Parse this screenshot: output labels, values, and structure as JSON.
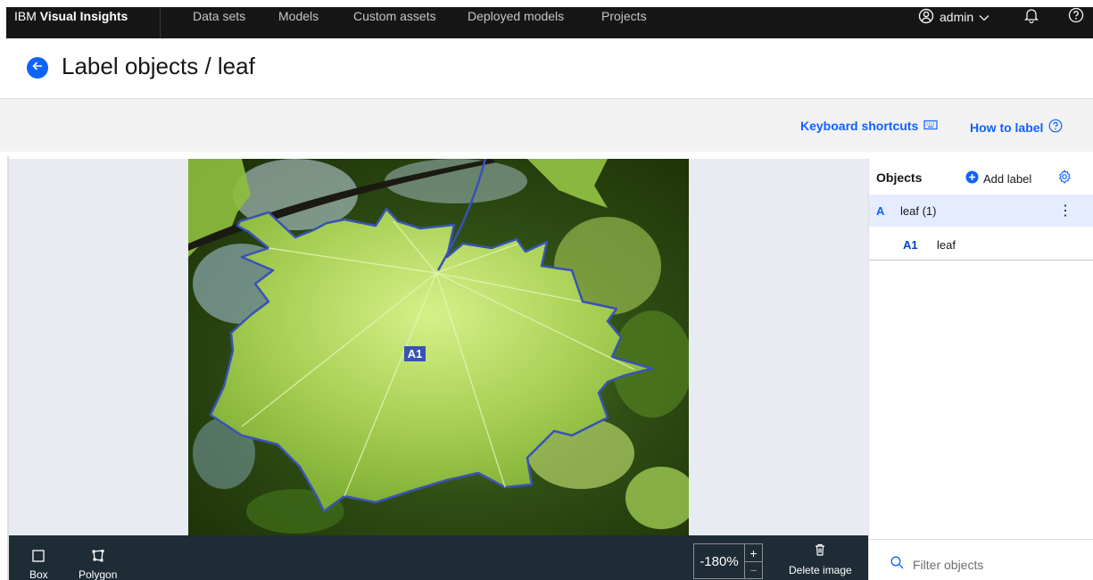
{
  "nav": {
    "brand_prefix": "IBM",
    "brand_name": "Visual Insights",
    "items": [
      "Data sets",
      "Models",
      "Custom assets",
      "Deployed models",
      "Projects"
    ],
    "user": "admin"
  },
  "header": {
    "title": "Label objects / leaf"
  },
  "toolbar": {
    "keyboard_shortcuts": "Keyboard shortcuts",
    "how_to_label": "How to label"
  },
  "canvas": {
    "box_tag": "A1"
  },
  "bottom": {
    "box_label": "Box",
    "polygon_label": "Polygon",
    "zoom_value": "-180%",
    "zoom_in": "+",
    "zoom_out": "−",
    "delete_label": "Delete image"
  },
  "panel": {
    "title": "Objects",
    "add_label": "Add label",
    "labels": [
      {
        "key": "A",
        "name": "leaf (1)"
      }
    ],
    "objects": [
      {
        "key": "A1",
        "name": "leaf"
      }
    ],
    "filter_placeholder": "Filter objects"
  },
  "colors": {
    "accent": "#0f62fe",
    "nav_bg": "#161616",
    "tool_bar_bg": "#1e2c36",
    "selected_row": "#e5ecff",
    "polygon_stroke": "#3a52b5"
  }
}
